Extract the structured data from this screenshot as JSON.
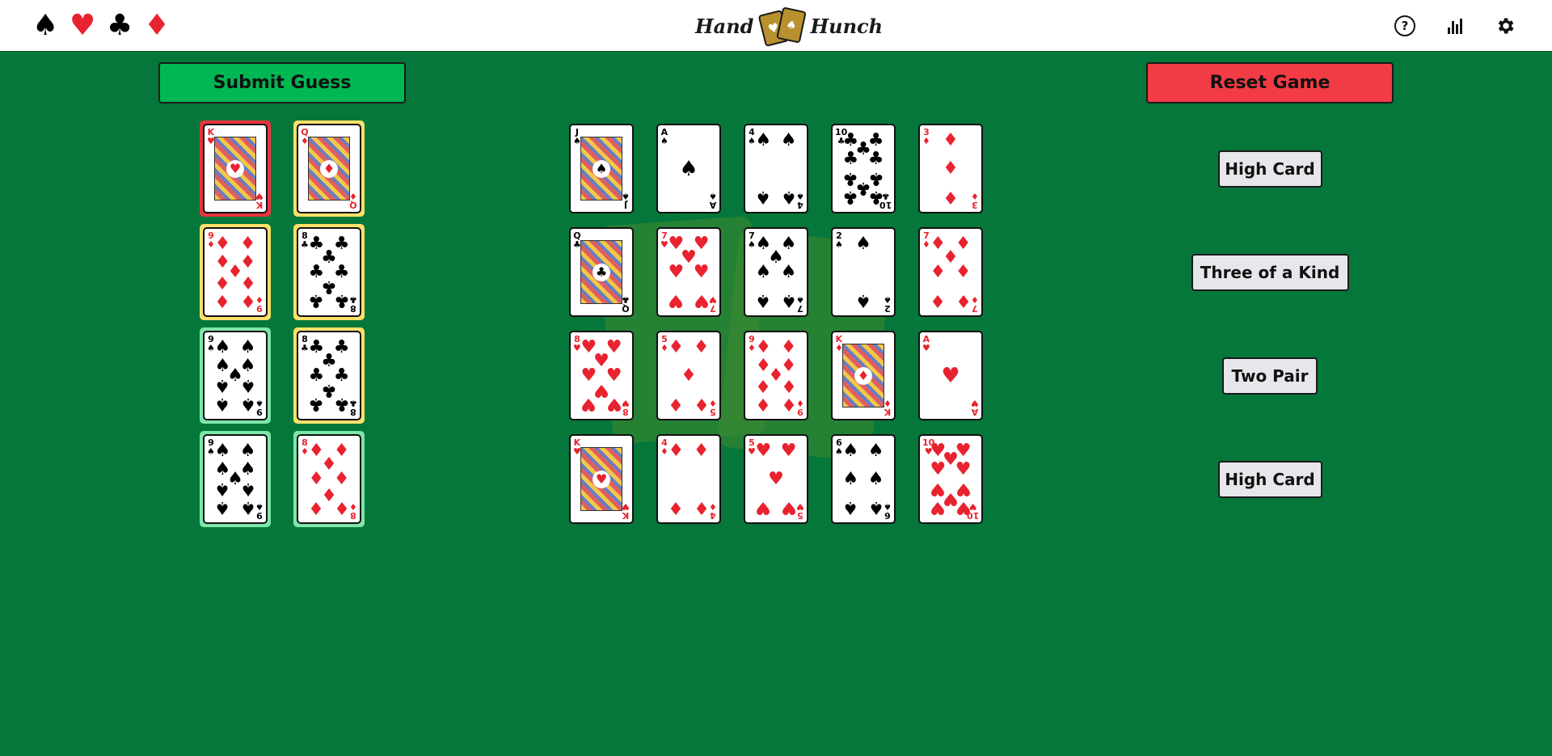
{
  "header": {
    "suits": [
      {
        "name": "spade-icon",
        "glyph": "♠",
        "color": "black"
      },
      {
        "name": "heart-icon",
        "glyph": "♥",
        "color": "red"
      },
      {
        "name": "club-icon",
        "glyph": "♣",
        "color": "black"
      },
      {
        "name": "diamond-icon",
        "glyph": "♦",
        "color": "red"
      }
    ],
    "brand_left": "Hand",
    "brand_right": "Hunch",
    "icons": [
      "help-icon",
      "stats-icon",
      "settings-icon"
    ]
  },
  "actions": {
    "submit_label": "Submit Guess",
    "reset_label": "Reset Game"
  },
  "colors": {
    "table_green": "#06773a",
    "submit_green": "#00b853",
    "reset_red": "#f23b45",
    "highlight_red": "#e8343f",
    "highlight_yellow": "#fbe06a",
    "highlight_green": "#7de6a9"
  },
  "guess_cards": [
    {
      "rank": "K",
      "suit": "♥",
      "status": "red"
    },
    {
      "rank": "Q",
      "suit": "♦",
      "status": "yellow"
    },
    {
      "rank": "9",
      "suit": "♦",
      "status": "yellow"
    },
    {
      "rank": "8",
      "suit": "♣",
      "status": "yellow"
    },
    {
      "rank": "9",
      "suit": "♠",
      "status": "green"
    },
    {
      "rank": "8",
      "suit": "♣",
      "status": "yellow"
    },
    {
      "rank": "9",
      "suit": "♠",
      "status": "green"
    },
    {
      "rank": "8",
      "suit": "♦",
      "status": "green"
    }
  ],
  "board_rows": [
    [
      {
        "rank": "J",
        "suit": "♠"
      },
      {
        "rank": "A",
        "suit": "♠"
      },
      {
        "rank": "4",
        "suit": "♠"
      },
      {
        "rank": "10",
        "suit": "♣"
      },
      {
        "rank": "3",
        "suit": "♦"
      }
    ],
    [
      {
        "rank": "Q",
        "suit": "♣"
      },
      {
        "rank": "7",
        "suit": "♥"
      },
      {
        "rank": "7",
        "suit": "♠"
      },
      {
        "rank": "2",
        "suit": "♠"
      },
      {
        "rank": "7",
        "suit": "♦"
      }
    ],
    [
      {
        "rank": "8",
        "suit": "♥"
      },
      {
        "rank": "5",
        "suit": "♦"
      },
      {
        "rank": "9",
        "suit": "♦"
      },
      {
        "rank": "K",
        "suit": "♦"
      },
      {
        "rank": "A",
        "suit": "♥"
      }
    ],
    [
      {
        "rank": "K",
        "suit": "♥"
      },
      {
        "rank": "4",
        "suit": "♦"
      },
      {
        "rank": "5",
        "suit": "♥"
      },
      {
        "rank": "6",
        "suit": "♠"
      },
      {
        "rank": "10",
        "suit": "♥"
      }
    ]
  ],
  "hand_labels": [
    "High Card",
    "Three of a Kind",
    "Two Pair",
    "High Card"
  ]
}
